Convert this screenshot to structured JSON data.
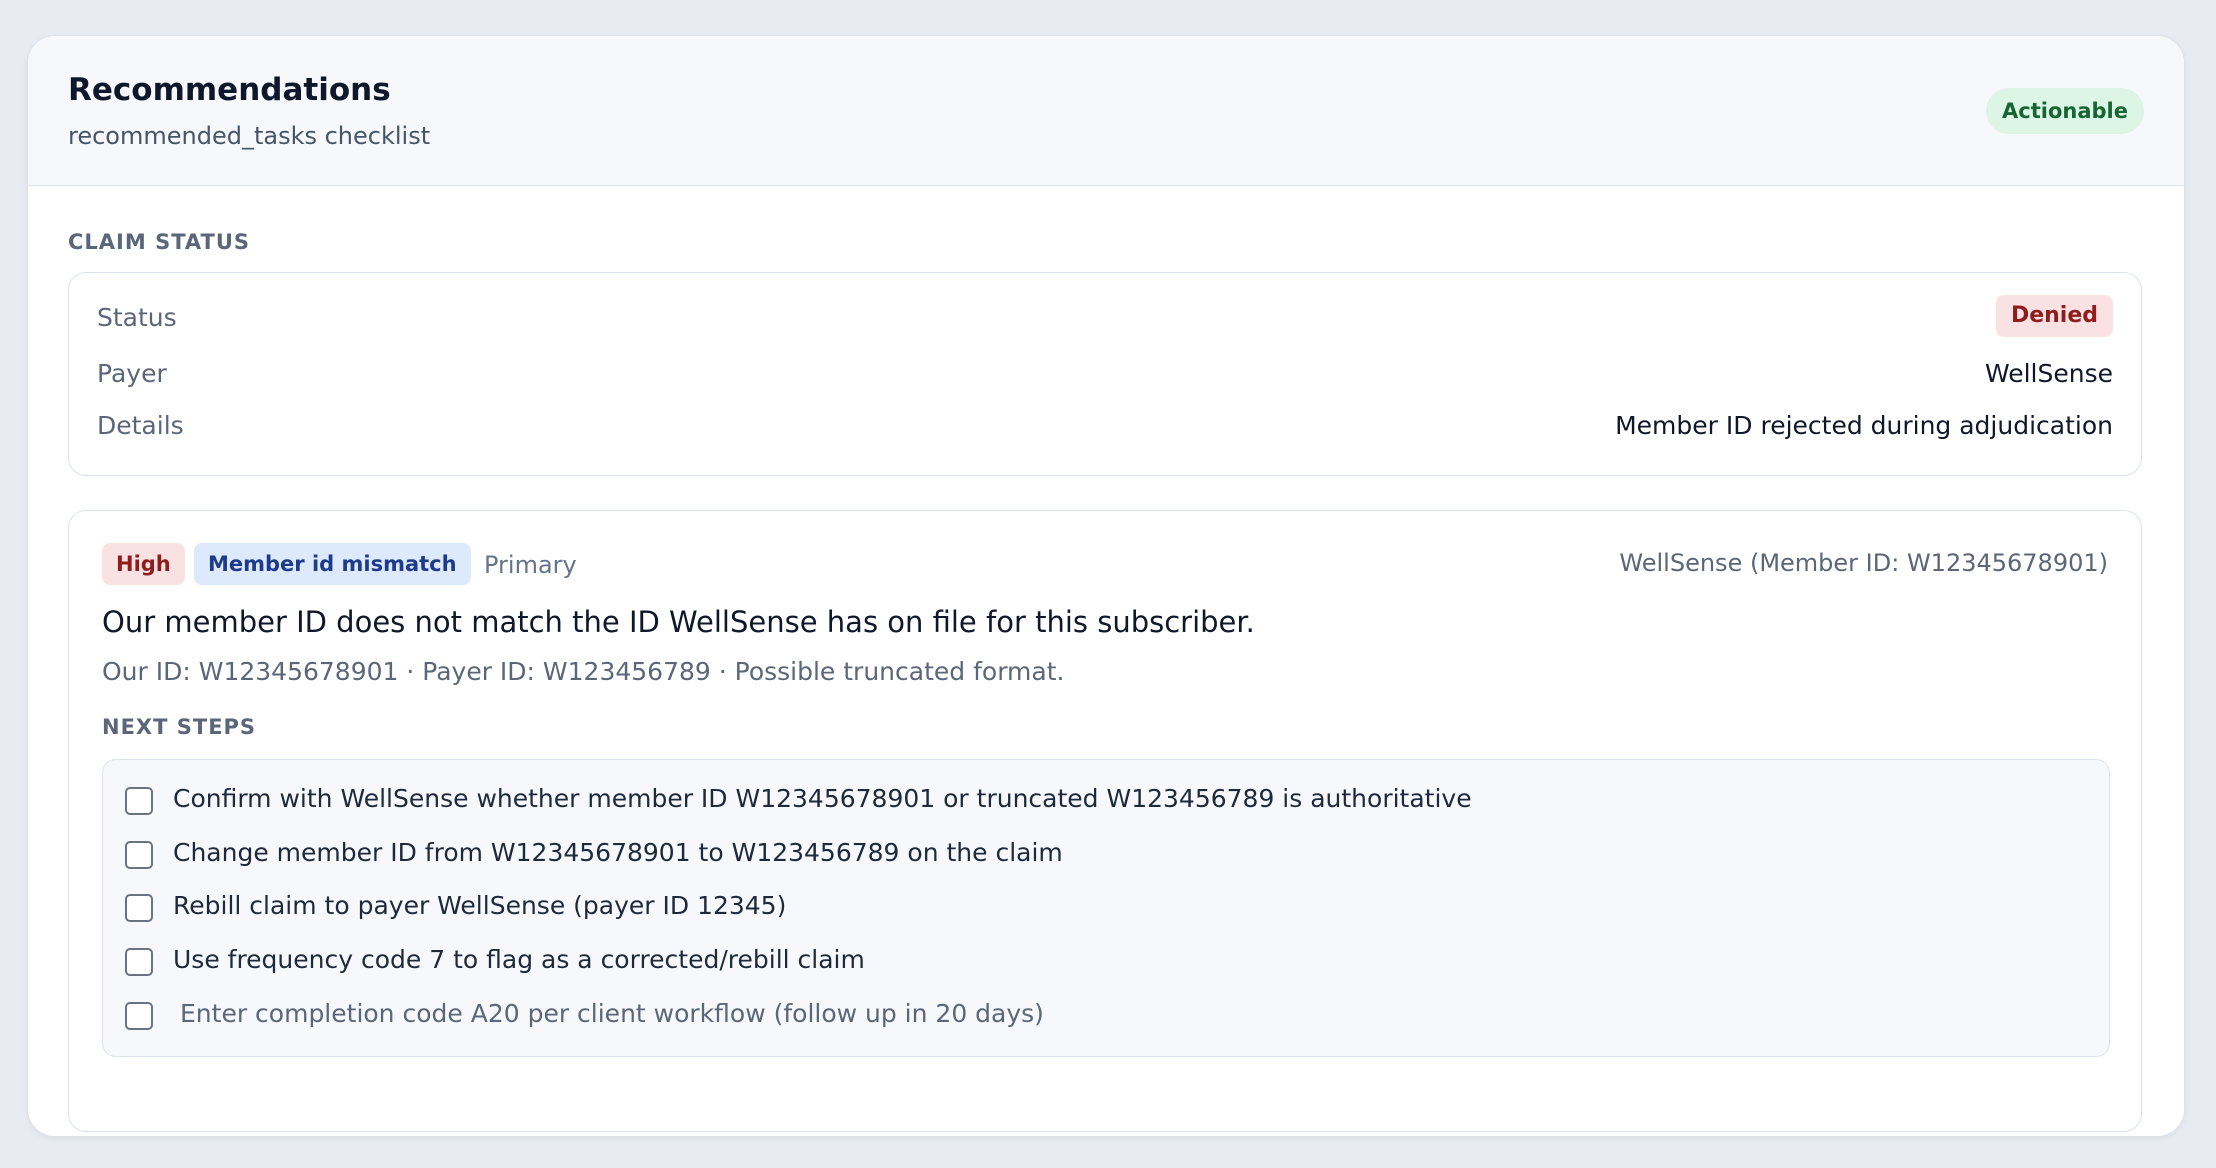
{
  "header": {
    "title": "Recommendations",
    "subtitle": "recommended_tasks checklist",
    "badge": "Actionable"
  },
  "claim_status": {
    "section_label": "CLAIM STATUS",
    "status_label": "Status",
    "status_value": "Denied",
    "payer_label": "Payer",
    "payer_value": "WellSense",
    "details_label": "Details",
    "details_value": "Member ID rejected during adjudication"
  },
  "issue": {
    "severity": "High",
    "category": "Member id mismatch",
    "rank": "Primary",
    "payer_ref": "WellSense (Member ID: W12345678901)",
    "title": "Our member ID does not match the ID WellSense has on file for this subscriber.",
    "detail": "Our ID: W12345678901 · Payer ID: W123456789 · Possible truncated format.",
    "next_steps_label": "NEXT STEPS",
    "steps": [
      {
        "label": "Confirm with WellSense whether member ID W12345678901 or truncated W123456789 is authoritative",
        "checked": false
      },
      {
        "label": "Change member ID from W12345678901 to W123456789 on the claim",
        "checked": false
      },
      {
        "label": "Rebill claim to payer WellSense (payer ID 12345)",
        "checked": false
      },
      {
        "label": "Use frequency code 7 to flag as a corrected/rebill claim",
        "checked": false
      },
      {
        "label": "Enter completion code A20 per client workflow (follow up in 20 days)",
        "checked": false
      }
    ]
  },
  "colors": {
    "actionable_bg": "#dcf5e4",
    "denied_bg": "#fbe2e2",
    "mismatch_bg": "#dde9fd"
  }
}
